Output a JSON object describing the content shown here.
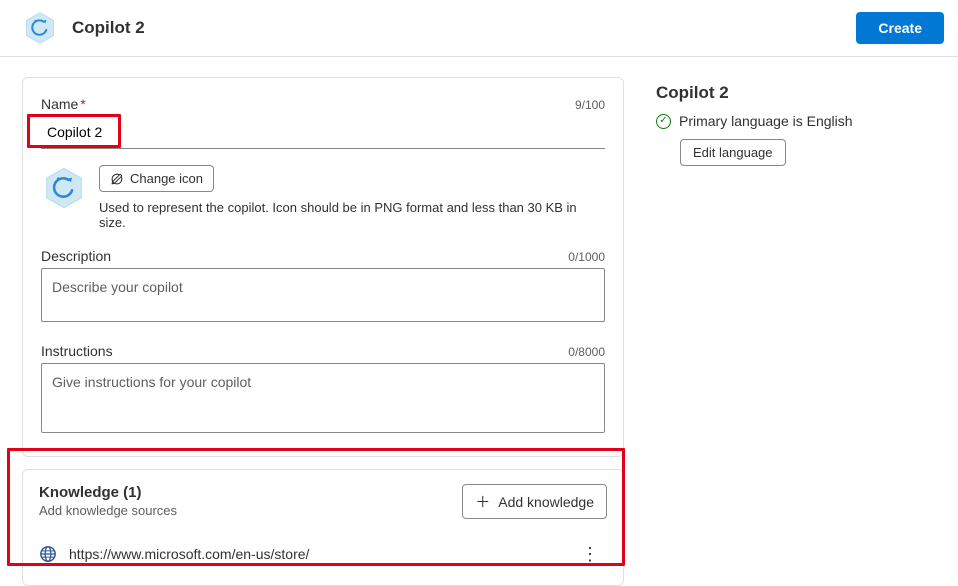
{
  "header": {
    "title": "Copilot 2",
    "create_label": "Create"
  },
  "form": {
    "name": {
      "label": "Name",
      "value": "Copilot 2",
      "count": "9/100"
    },
    "icon": {
      "change_label": "Change icon",
      "helper": "Used to represent the copilot. Icon should be in PNG format and less than 30 KB in size."
    },
    "description": {
      "label": "Description",
      "placeholder": "Describe your copilot",
      "count": "0/1000"
    },
    "instructions": {
      "label": "Instructions",
      "placeholder": "Give instructions for your copilot",
      "count": "0/8000"
    }
  },
  "knowledge": {
    "title": "Knowledge (1)",
    "subtitle": "Add knowledge sources",
    "add_label": "Add knowledge",
    "items": [
      {
        "url": "https://www.microsoft.com/en-us/store/"
      }
    ]
  },
  "sidebar": {
    "title": "Copilot 2",
    "status": "Primary language is English",
    "edit_label": "Edit language"
  }
}
